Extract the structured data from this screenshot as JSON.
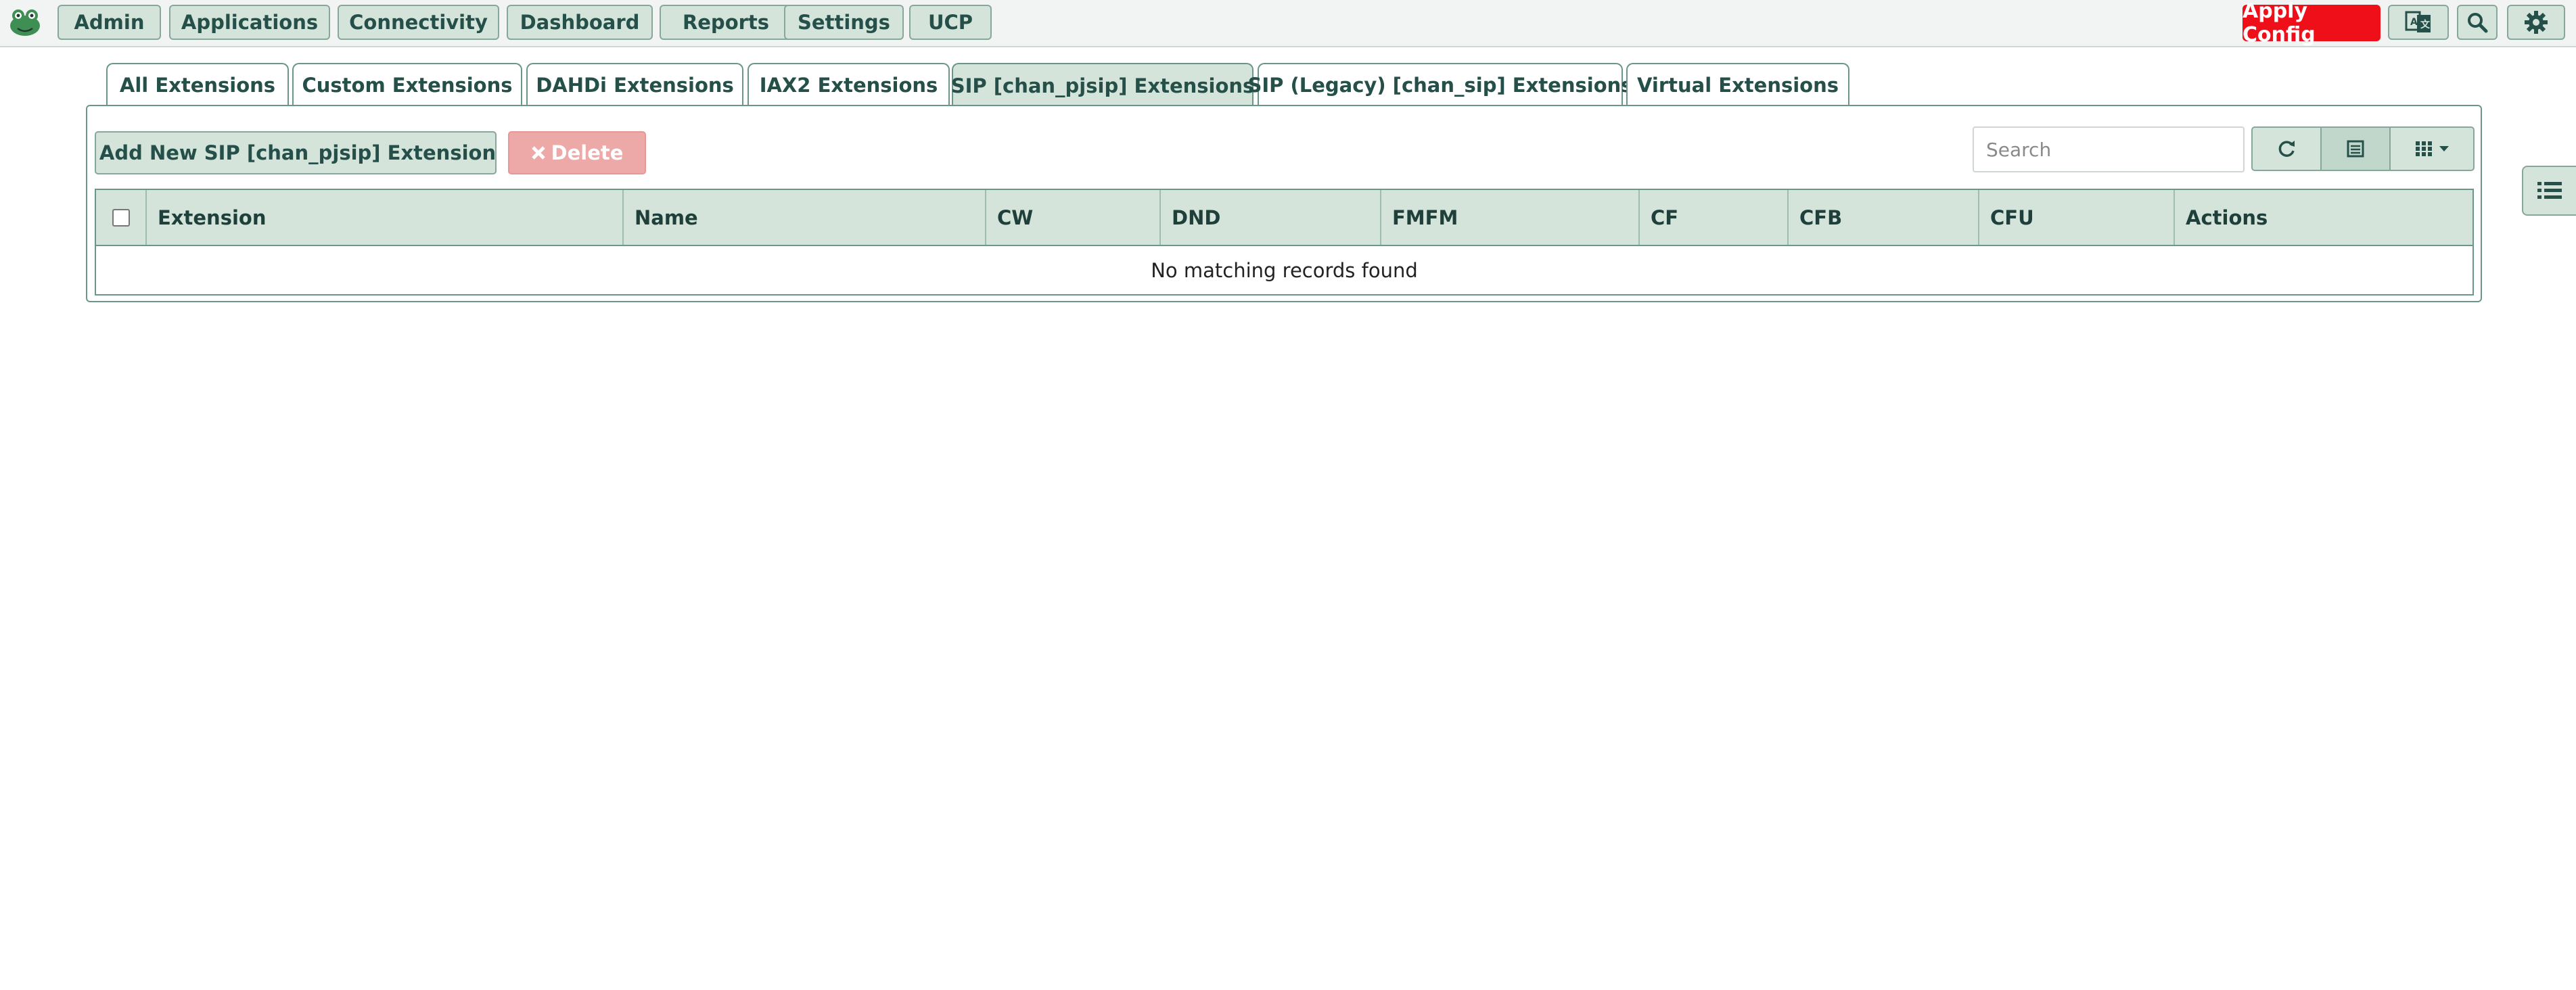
{
  "nav": {
    "items": [
      "Admin",
      "Applications",
      "Connectivity",
      "Dashboard",
      "Reports",
      "Settings",
      "UCP"
    ],
    "apply_label": "Apply Config"
  },
  "tabs": {
    "items": [
      "All Extensions",
      "Custom Extensions",
      "DAHDi Extensions",
      "IAX2 Extensions",
      "SIP [chan_pjsip] Extensions",
      "SIP (Legacy) [chan_sip] Extensions",
      "Virtual Extensions"
    ],
    "active": "SIP [chan_pjsip] Extensions"
  },
  "toolbar": {
    "add_label": "Add New SIP [chan_pjsip] Extension",
    "delete_label": "Delete",
    "search_placeholder": "Search"
  },
  "table": {
    "columns": [
      "Extension",
      "Name",
      "CW",
      "DND",
      "FMFM",
      "CF",
      "CFB",
      "CFU",
      "Actions"
    ],
    "empty_message": "No matching records found"
  },
  "colors": {
    "accent": "#d4e4db",
    "border": "#6b968a",
    "apply": "#ef0f18",
    "delete_disabled": "#eda8a8"
  },
  "icons": [
    "logo-icon",
    "language-icon",
    "search-icon",
    "gear-icon",
    "plus-icon",
    "close-icon",
    "refresh-icon",
    "list-view-icon",
    "columns-icon",
    "caret-down-icon",
    "sidebar-list-icon"
  ]
}
